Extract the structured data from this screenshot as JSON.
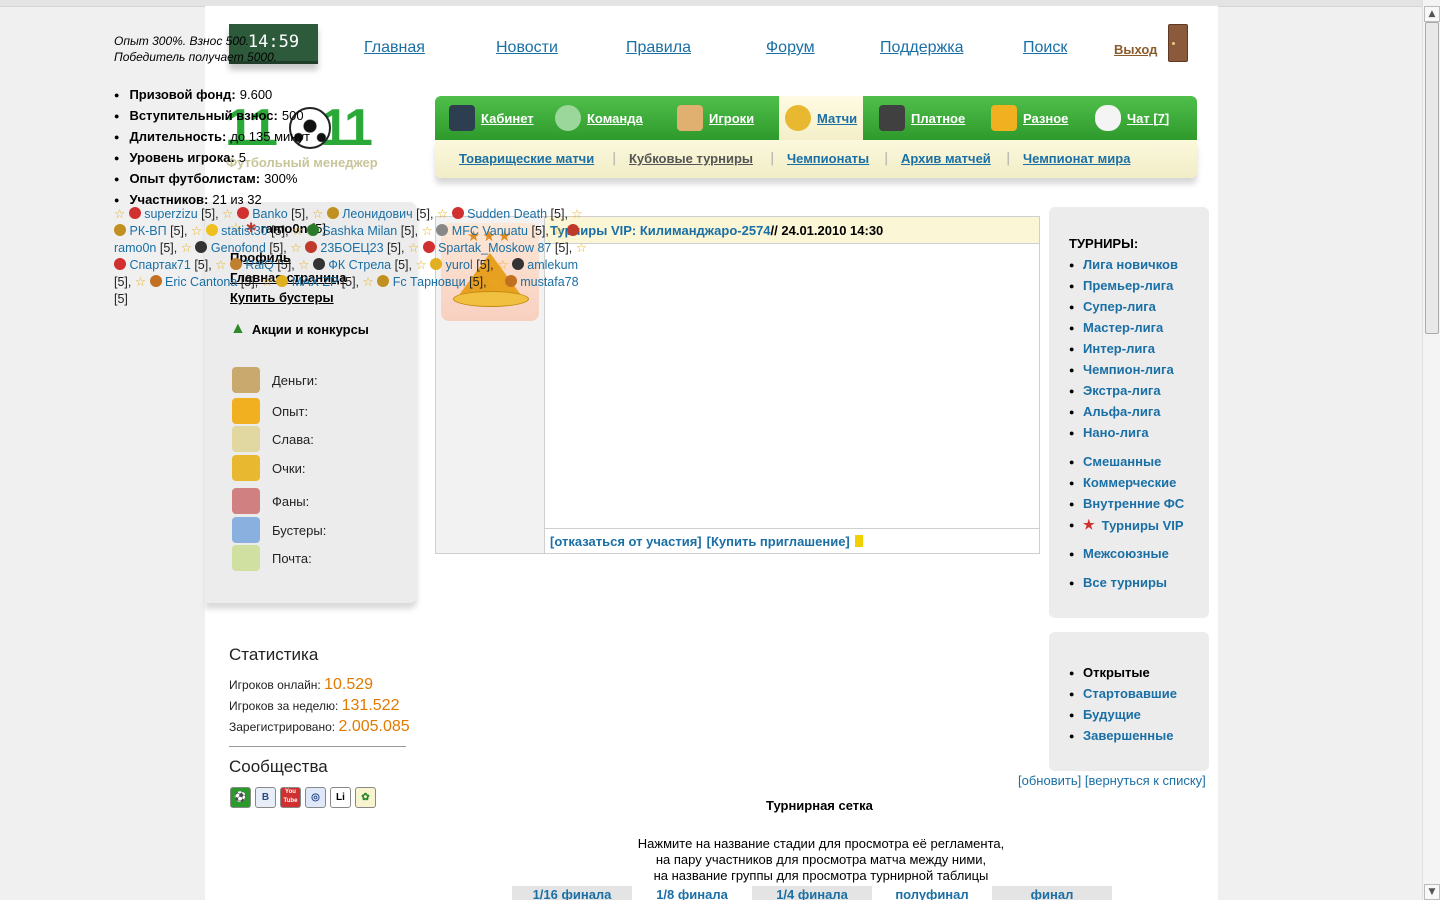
{
  "clock": "14:59",
  "top_links": [
    "Главная",
    "Новости",
    "Правила",
    "Форум",
    "Поддержка",
    "Поиск"
  ],
  "exit_label": "Выход",
  "logo": {
    "left": "11",
    "right": "11",
    "subtitle": "Футбольный менеджер"
  },
  "nav": [
    {
      "label": "Кабинет",
      "icon": "manager-icon"
    },
    {
      "label": "Команда",
      "icon": "stadium-icon"
    },
    {
      "label": "Игроки",
      "icon": "players-icon"
    },
    {
      "label": "Матчи",
      "icon": "trophy-ball-icon"
    },
    {
      "label": "Платное",
      "icon": "coins-icon"
    },
    {
      "label": "Разное",
      "icon": "beer-icon"
    },
    {
      "label": "Чат [7]",
      "icon": "chat-icon"
    }
  ],
  "subnav": [
    "Товарищеские матчи",
    "Кубковые турниры",
    "Чемпионаты",
    "Архив матчей",
    "Чемпионат мира"
  ],
  "user": {
    "name": "ramo0n",
    "level": "[5]"
  },
  "left_menu": [
    "Профиль",
    "Главная страница",
    "Купить бустеры"
  ],
  "promo_label": "Акции и конкурсы",
  "stats_list": [
    "Деньги:",
    "Опыт:",
    "Слава:",
    "Очки:",
    "Фаны:",
    "Бустеры:",
    "Почта:"
  ],
  "statistics": {
    "title": "Статистика",
    "online_label": "Игроков онлайн:",
    "online_value": "10.529",
    "week_label": "Игроков за неделю:",
    "week_value": "131.522",
    "reg_label": "Зарегистрировано:",
    "reg_value": "2.005.085"
  },
  "communities": {
    "title": "Сообщества",
    "items": [
      "⚽",
      "B",
      "You Tube",
      "◎",
      "Li",
      "✿"
    ]
  },
  "tournament": {
    "title_link": "Турниры VIP: Килиманджаро-2574",
    "title_rest": " // 24.01.2010 14:30",
    "desc1": "Опыт 300%. Взнос 500.",
    "desc2": "Победитель получает 5000.",
    "facts": [
      {
        "label": "Призовой фонд:",
        "value": "9.600"
      },
      {
        "label": "Вступительный взнос:",
        "value": "500"
      },
      {
        "label": "Длительность:",
        "value": "до 135 минут"
      },
      {
        "label": "Уровень игрока:",
        "value": "5"
      },
      {
        "label": "Опыт футболистам:",
        "value": "300%"
      },
      {
        "label": "Участников:",
        "value": "21 из 32"
      }
    ],
    "participants": [
      "superzizu",
      "Banko",
      "Леонидович",
      "Sudden Death",
      "РК-ВП",
      "statist30",
      "Sashka Milan",
      "MFC Vanuatu",
      "ramo0n",
      "Genofond",
      "23БОЕЦ23",
      "Spartak_Moskow 87",
      "Спартак71",
      "RaiQ",
      "ФК Стрела",
      "yurol",
      "amlekum",
      "Eric Cantona",
      "MAX ZP",
      "Fc Тарновци",
      "mustafa78"
    ],
    "participant_level": "[5]",
    "decline": "[отказаться от участия]",
    "buy_invite": "[Купить приглашение]"
  },
  "right_panel": {
    "title": "ТУРНИРЫ:",
    "links": [
      "Лига новичков",
      "Премьер-лига",
      "Супер-лига",
      "Мастер-лига",
      "Интер-лига",
      "Чемпион-лига",
      "Экстра-лига",
      "Альфа-лига",
      "Нано-лига"
    ],
    "links2": [
      "Смешанные",
      "Коммерческие",
      "Внутренние ФС",
      "Турниры VIP"
    ],
    "links3": [
      "Межсоюзные"
    ],
    "links4": [
      "Все турниры"
    ]
  },
  "status_panel": {
    "current": "Открытые",
    "links": [
      "Стартовавшие",
      "Будущие",
      "Завершенные"
    ]
  },
  "refresh": "[обновить]",
  "back_to_list": "[вернуться к списку]",
  "grid": {
    "title": "Турнирная сетка",
    "hint1": "Нажмите на название стадии для просмотра её регламента,",
    "hint2": "на пару участников для просмотра матча между ними,",
    "hint3": "на название группы для просмотра турнирной таблицы",
    "stages": [
      "1/16 финала",
      "1/8 финала",
      "1/4 финала",
      "полуфинал",
      "финал"
    ]
  },
  "colors": {
    "nav_green": "#3cae3a",
    "link_blue": "#1a6fa5",
    "accent_orange": "#e07b00",
    "panel_gray": "#ececec"
  }
}
